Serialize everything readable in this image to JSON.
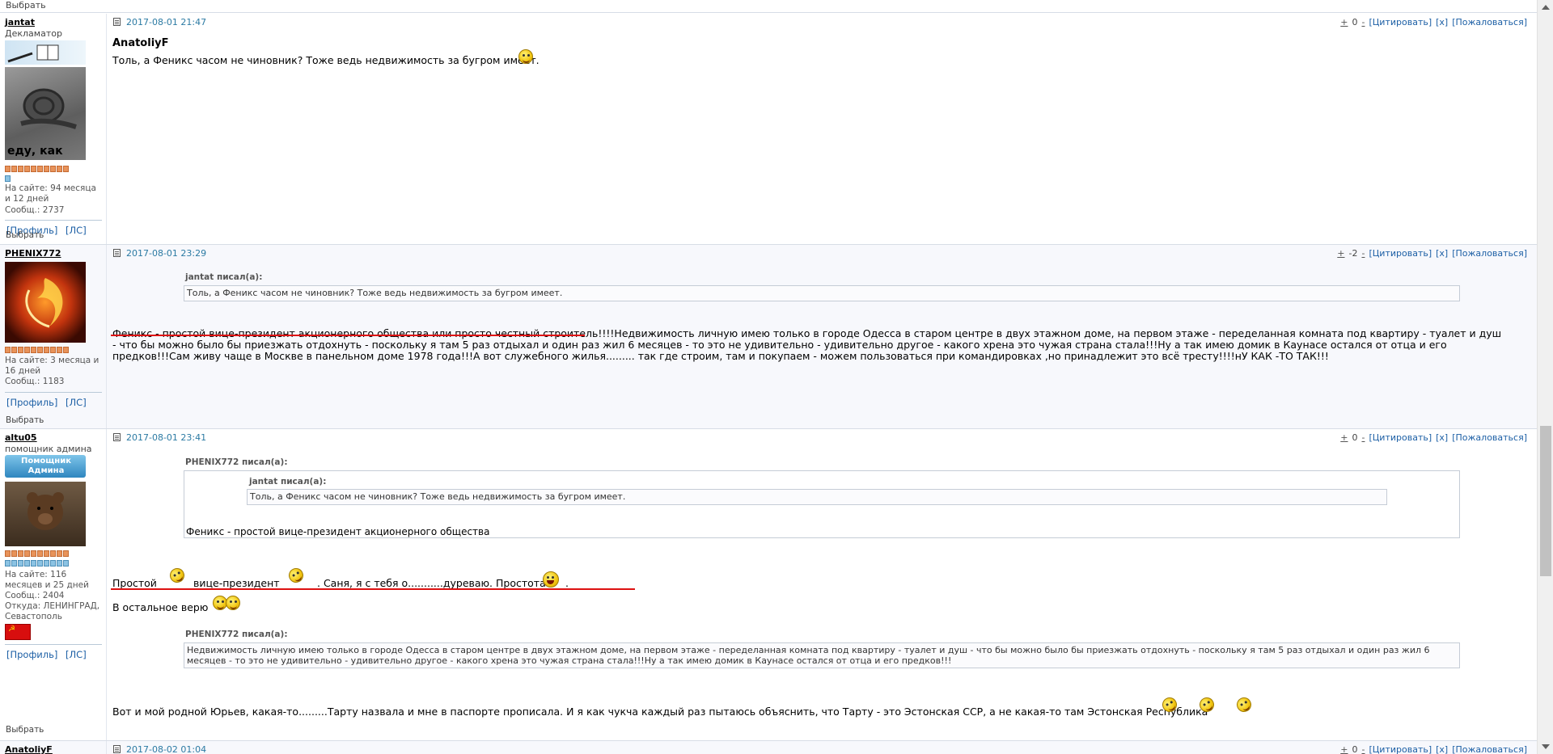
{
  "top_strip": {
    "select_label": "Выбрать"
  },
  "posts": [
    {
      "author": "jantat",
      "title": "Декламатор",
      "avatar_caption": "еду, как могу",
      "stats": [
        "На сайте: 94 месяца и 12 дней",
        "Сообщ.: 2737"
      ],
      "profile_label": "[Профиль]",
      "pm_label": "[ЛС]",
      "select_label": "Выбрать",
      "date": "2017-08-01 21:47",
      "plus": "+",
      "score": "0",
      "minus": "-",
      "quote_btn": "[Цитировать]",
      "x_btn": "[x]",
      "report_btn": "[Пожаловаться]",
      "addressee": "AnatoliyF",
      "text": "Толь, а Феникс часом не чиновник? Тоже ведь недвижимость за бугром имеет."
    },
    {
      "author": "PHENIX772",
      "stats": [
        "На сайте: 3 месяца и 16 дней",
        "Сообщ.: 1183"
      ],
      "profile_label": "[Профиль]",
      "pm_label": "[ЛС]",
      "select_label": "Выбрать",
      "date": "2017-08-01 23:29",
      "plus": "+",
      "score": "-2",
      "minus": "-",
      "quote_btn": "[Цитировать]",
      "x_btn": "[x]",
      "report_btn": "[Пожаловаться]",
      "quote_author": "jantat писал(а):",
      "quote_text": "Толь, а Феникс часом не чиновник? Тоже ведь недвижимость за бугром имеет.",
      "text": "Феникс - простой вице-президент акционерного общества или просто честный строитель!!!!Недвижимость личную имею только в городе Одесса в старом центре в двух этажном доме, на первом этаже - переделанная комната под квартиру - туалет и душ - что бы можно было бы приезжать отдохнуть - поскольку я там 5 раз отдыхал и один раз жил 6 месяцев - то это не удивительно - удивительно другое - какого хрена это чужая страна стала!!!Ну а так имею домик в Каунасе остался от отца и его предков!!!Сам живу чаще в Москве в панельном доме 1978 года!!!А вот служебного жилья......... так где строим, там и покупаем - можем пользоваться при командировках ,но принадлежит это всё тресту!!!!нУ КАК -ТО ТАК!!!"
    },
    {
      "author": "altu05",
      "title": "помощник админа",
      "badge_text": "Помощник Админа",
      "stats": [
        "На сайте: 116 месяцев и 25 дней",
        "Сообщ.: 2404",
        "Откуда: ЛЕНИНГРАД, Севастополь"
      ],
      "profile_label": "[Профиль]",
      "pm_label": "[ЛС]",
      "select_label": "Выбрать",
      "date": "2017-08-01 23:41",
      "plus": "+",
      "score": "0",
      "minus": "-",
      "quote_btn": "[Цитировать]",
      "x_btn": "[x]",
      "report_btn": "[Пожаловаться]",
      "quote_author": "PHENIX772 писал(а):",
      "nested_quote_author": "jantat писал(а):",
      "nested_quote_text": "Толь, а Феникс часом не чиновник? Тоже ведь недвижимость за бугром имеет.",
      "quote_text": "Феникс - простой вице-президент акционерного общества",
      "line1_a": "Простой",
      "line1_b": "вице-президент",
      "line1_c": ". Саня, я с тебя о...........дуреваю. Простота",
      "line1_d": ".",
      "line2": "В остальное верю",
      "quote2_author": "PHENIX772 писал(а):",
      "quote2_text": "Недвижимость личную имею только в городе Одесса в старом центре в двух этажном доме, на первом этаже - переделанная комната под квартиру - туалет и душ - что бы можно было бы приезжать отдохнуть - поскольку я там 5 раз отдыхал и один раз жил 6 месяцев - то это не удивительно - удивительно другое - какого хрена это чужая страна стала!!!Ну а так имею домик в Каунасе остался от отца и его предков!!!",
      "line3": "Вот и мой родной Юрьев, какая-то.........Тарту назвала и мне в паспорте прописала. И я как чукча каждый раз пытаюсь объяснить, что Тарту - это Эстонская ССР, а не какая-то там Эстонская Республика"
    },
    {
      "author": "AnatoliyF",
      "date": "2017-08-02 01:04",
      "plus": "+",
      "score": "0",
      "minus": "-",
      "quote_btn": "[Цитировать]",
      "x_btn": "[x]",
      "report_btn": "[Пожаловаться]"
    }
  ]
}
